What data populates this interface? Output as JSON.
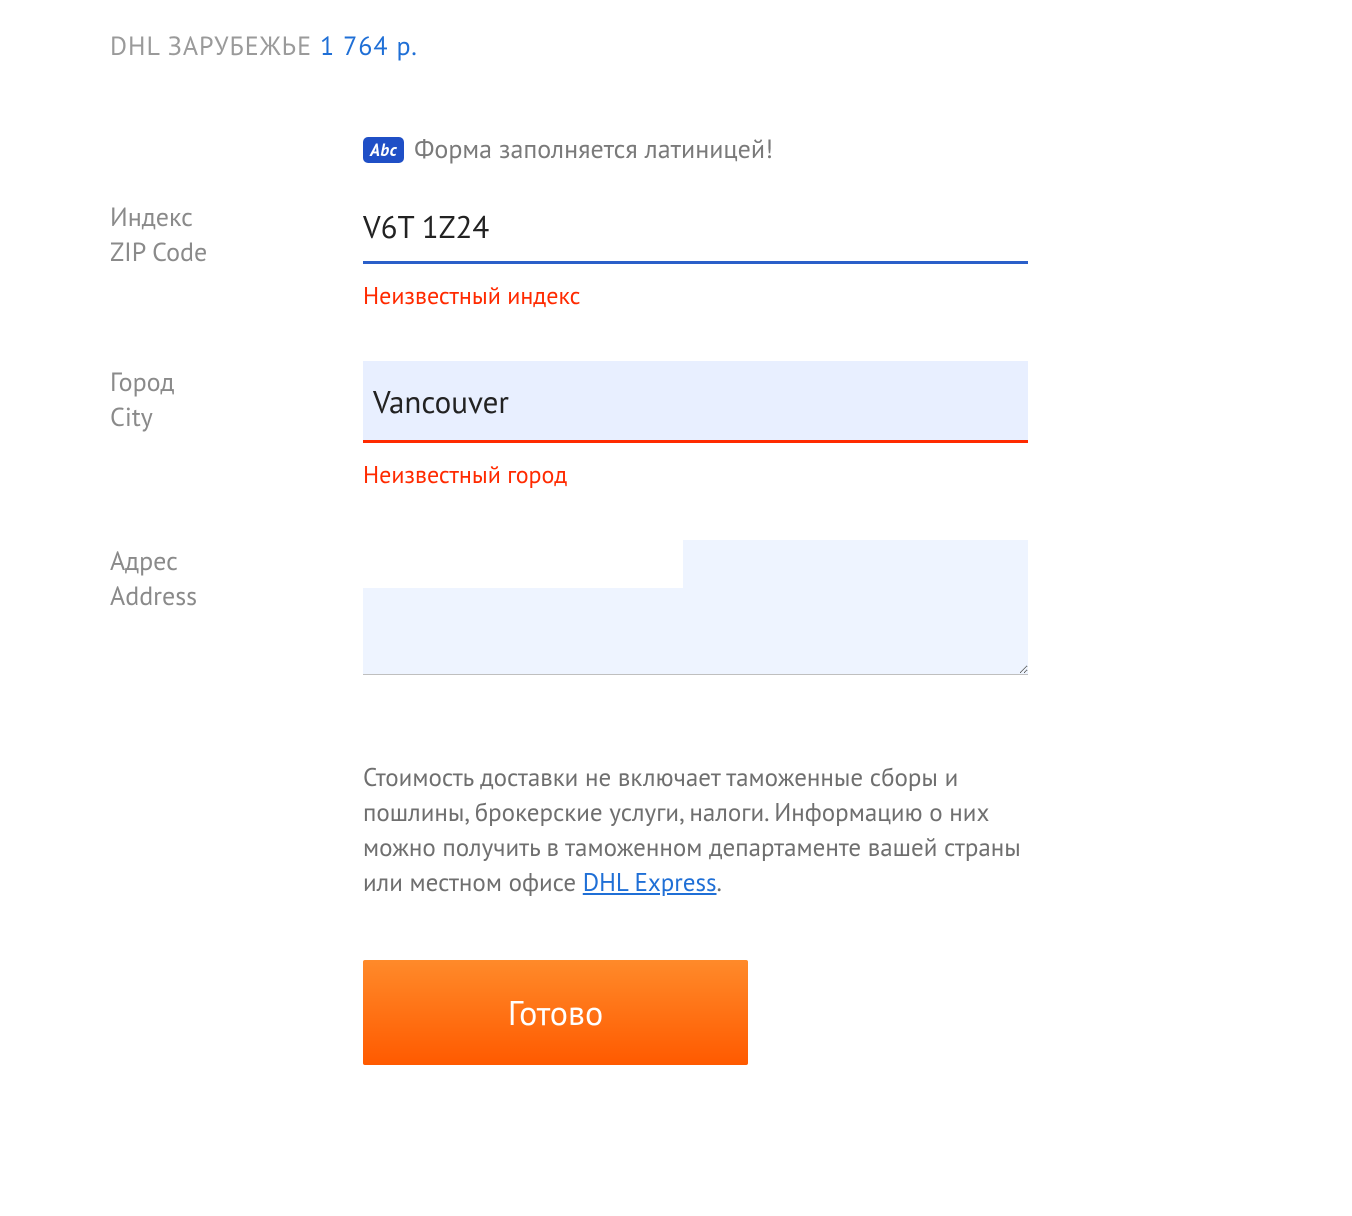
{
  "header": {
    "title": "DHL ЗАРУБЕЖЬЕ",
    "price": "1 764 р."
  },
  "notice": {
    "badge": "Abc",
    "text": "Форма заполняется латиницей!"
  },
  "fields": {
    "zip": {
      "label_ru": "Индекс",
      "label_en": "ZIP Code",
      "value": "V6T 1Z24",
      "error": "Неизвестный индекс"
    },
    "city": {
      "label_ru": "Город",
      "label_en": "City",
      "value": "Vancouver",
      "error": "Неизвестный город"
    },
    "address": {
      "label_ru": "Адрес",
      "label_en": "Address",
      "value": ""
    }
  },
  "disclaimer": {
    "text_before": "Стоимость доставки не включает таможенные сборы и пошлины, брокерские услуги, налоги. Информацию о них можно получить в таможенном департаменте вашей страны или местном офисе ",
    "link_text": "DHL Express",
    "text_after": "."
  },
  "submit": {
    "label": "Готово"
  }
}
